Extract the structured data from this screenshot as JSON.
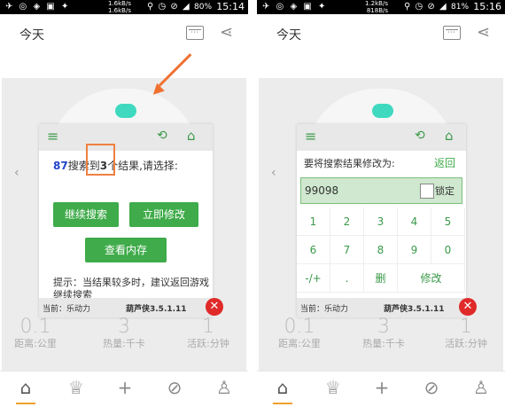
{
  "status_bar": {
    "left_icons": "✈ ◎ ◈ ▣ ✦",
    "right_icons": "⚲ ◷ ⊘ ◢",
    "left_panel": {
      "speed_up": "1.6kB/s",
      "speed_down": "1.6kB/s",
      "battery": "80%",
      "time": "15:14"
    },
    "right_panel": {
      "speed_up": "1.2kB/s",
      "speed_down": "818B/s",
      "battery": "81%",
      "time": "15:16"
    }
  },
  "app": {
    "title": "今天",
    "icons": {
      "calendar": "calendar-icon",
      "share": "share-icon"
    }
  },
  "stats": [
    {
      "value": "0.1",
      "label": "距离:公里"
    },
    {
      "value": "3",
      "label": "热量:千卡"
    },
    {
      "value": "1",
      "label": "活跃:分钟"
    }
  ],
  "bottom_nav": [
    "home-icon",
    "trophy-icon",
    "plus-icon",
    "compass-icon",
    "user-icon"
  ],
  "overlay_common": {
    "current_label": "当前：乐动力",
    "version": "葫芦侠3.5.1.11"
  },
  "left_overlay": {
    "count": "87",
    "text_1": "搜索到",
    "result": "3",
    "text_2": "个结果,请选择:",
    "btn_continue": "继续搜索",
    "btn_modify": "立即修改",
    "btn_view": "查看内存",
    "hint": "提示：当结果较多时，建议返回游戏继续搜索"
  },
  "right_overlay": {
    "prompt": "要将搜索结果修改为:",
    "back": "返回",
    "input_value": "99098",
    "lock_label": "锁定",
    "keys": [
      "1",
      "2",
      "3",
      "4",
      "5",
      "6",
      "7",
      "8",
      "9",
      "0",
      "-/+",
      ".",
      "删",
      "修改"
    ]
  },
  "colors": {
    "accent_green": "#3fab4a",
    "highlight_orange": "#f07030",
    "close_red": "#e02a2a",
    "teal_pill": "#3fd9c0"
  }
}
